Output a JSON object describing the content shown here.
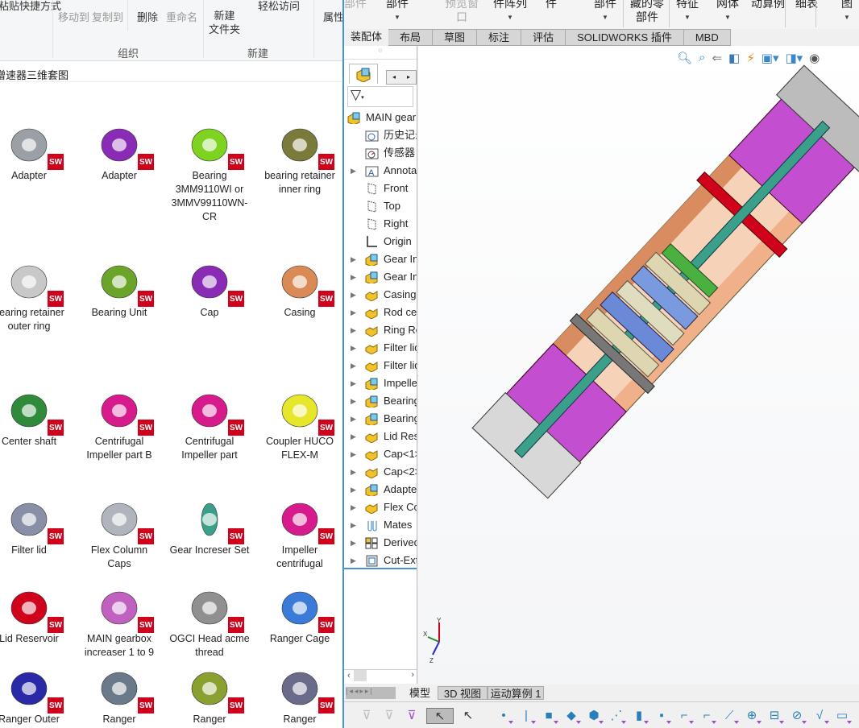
{
  "explorer": {
    "ribbon": {
      "paste_shortcut": "粘贴快捷方式",
      "move_to": "移动到",
      "copy_to": "复制到",
      "delete": "删除",
      "rename": "重命名",
      "new_folder": "新建\n文件夹",
      "easy_access": "轻松访问",
      "properties": "属性",
      "group_organize": "组织",
      "group_new": "新建"
    },
    "path": "增速器三维套图",
    "files": [
      {
        "label": "Adapter",
        "color": "#9aa0a6"
      },
      {
        "label": "Adapter",
        "color": "#8a2bb5"
      },
      {
        "label": "Bearing 3MM9110WI or 3MMV99110WN-CR",
        "color": "#7ed321"
      },
      {
        "label": "bearing retainer inner ring",
        "color": "#7a7a3a"
      },
      {
        "label": "bearing retainer outer ring",
        "color": "#c8c8c8"
      },
      {
        "label": "Bearing Unit",
        "color": "#6aa52a"
      },
      {
        "label": "Cap",
        "color": "#8a2bb5"
      },
      {
        "label": "Casing",
        "color": "#d98a55"
      },
      {
        "label": "Center shaft",
        "color": "#2f8a3a"
      },
      {
        "label": "Centrifugal Impeller part B",
        "color": "#d81b8c"
      },
      {
        "label": "Centrifugal Impeller part",
        "color": "#d81b8c"
      },
      {
        "label": "Coupler HUCO FLEX-M",
        "color": "#e6e62a"
      },
      {
        "label": "Filter lid",
        "color": "#8a8fa8"
      },
      {
        "label": "Flex Column Caps",
        "color": "#b0b4bc"
      },
      {
        "label": "Gear Increser Set",
        "color": "#3aa08a"
      },
      {
        "label": "Impeller centrifugal",
        "color": "#d81b8c"
      },
      {
        "label": "Lid Reservoir",
        "color": "#d0021b"
      },
      {
        "label": "MAIN gearbox increaser 1 to 9",
        "color": "#c060c0"
      },
      {
        "label": "OGCI Head acme thread",
        "color": "#909090"
      },
      {
        "label": "Ranger Cage",
        "color": "#3a7ad8"
      },
      {
        "label": "Ranger Outer",
        "color": "#2a2aa8"
      },
      {
        "label": "Ranger",
        "color": "#6a7a8a"
      },
      {
        "label": "Ranger",
        "color": "#8aa030"
      },
      {
        "label": "Ranger",
        "color": "#6a6a8a"
      }
    ],
    "badge": "SW"
  },
  "sw": {
    "ribbon": [
      {
        "label": "部件",
        "disabled": true
      },
      {
        "label": "部件",
        "arrow": true
      },
      {
        "label": "预览窗\n口",
        "disabled": true
      },
      {
        "label": "件阵列",
        "arrow": true
      },
      {
        "label": "件"
      },
      {
        "label": "部件",
        "arrow": true
      },
      {
        "label": "藏的零\n部件"
      },
      {
        "label": "特征",
        "arrow": true
      },
      {
        "label": "网体",
        "arrow": true
      },
      {
        "label": "动算例"
      },
      {
        "label": "细表"
      },
      {
        "label": "图",
        "arrow": true
      }
    ],
    "tabs": [
      "装配体",
      "布局",
      "草图",
      "标注",
      "评估",
      "SOLIDWORKS 插件",
      "MBD"
    ],
    "tree": [
      {
        "label": "MAIN gearbox",
        "icon": "assembly",
        "exp": false
      },
      {
        "label": "历史记录",
        "icon": "history-folder",
        "exp": false
      },
      {
        "label": "传感器",
        "icon": "sensor-folder",
        "exp": false
      },
      {
        "label": "Annotations",
        "icon": "annotation",
        "exp": true
      },
      {
        "label": "Front",
        "icon": "plane",
        "exp": false
      },
      {
        "label": "Top",
        "icon": "plane",
        "exp": false
      },
      {
        "label": "Right",
        "icon": "plane",
        "exp": false
      },
      {
        "label": "Origin",
        "icon": "origin",
        "exp": false
      },
      {
        "label": "Gear Increser",
        "icon": "subassembly",
        "exp": true
      },
      {
        "label": "Gear Increser",
        "icon": "subassembly",
        "exp": true
      },
      {
        "label": "Casing",
        "icon": "part",
        "exp": true
      },
      {
        "label": "Rod center",
        "icon": "part",
        "exp": true
      },
      {
        "label": "Ring Retainer",
        "icon": "part",
        "exp": true
      },
      {
        "label": "Filter lid",
        "icon": "part",
        "exp": true
      },
      {
        "label": "Filter lid",
        "icon": "part",
        "exp": true
      },
      {
        "label": "Impeller",
        "icon": "subassembly",
        "exp": true
      },
      {
        "label": "Bearing",
        "icon": "subassembly",
        "exp": true
      },
      {
        "label": "Bearing",
        "icon": "subassembly",
        "exp": true
      },
      {
        "label": "Lid Reservoir",
        "icon": "part",
        "exp": true
      },
      {
        "label": "Cap<1>",
        "icon": "part",
        "exp": true
      },
      {
        "label": "Cap<2>",
        "icon": "part",
        "exp": true
      },
      {
        "label": "Adapter",
        "icon": "subassembly",
        "exp": true
      },
      {
        "label": "Flex Column",
        "icon": "part",
        "exp": true
      },
      {
        "label": "Mates",
        "icon": "mates",
        "exp": true
      },
      {
        "label": "Derived",
        "icon": "derived",
        "exp": true
      },
      {
        "label": "Cut-Extrude",
        "icon": "cut-extrude",
        "exp": true
      }
    ],
    "bottom_tabs": [
      "模型",
      "3D 视图",
      "运动算例 1"
    ],
    "triad": {
      "x": "X",
      "y": "Y",
      "z": "Z"
    }
  }
}
